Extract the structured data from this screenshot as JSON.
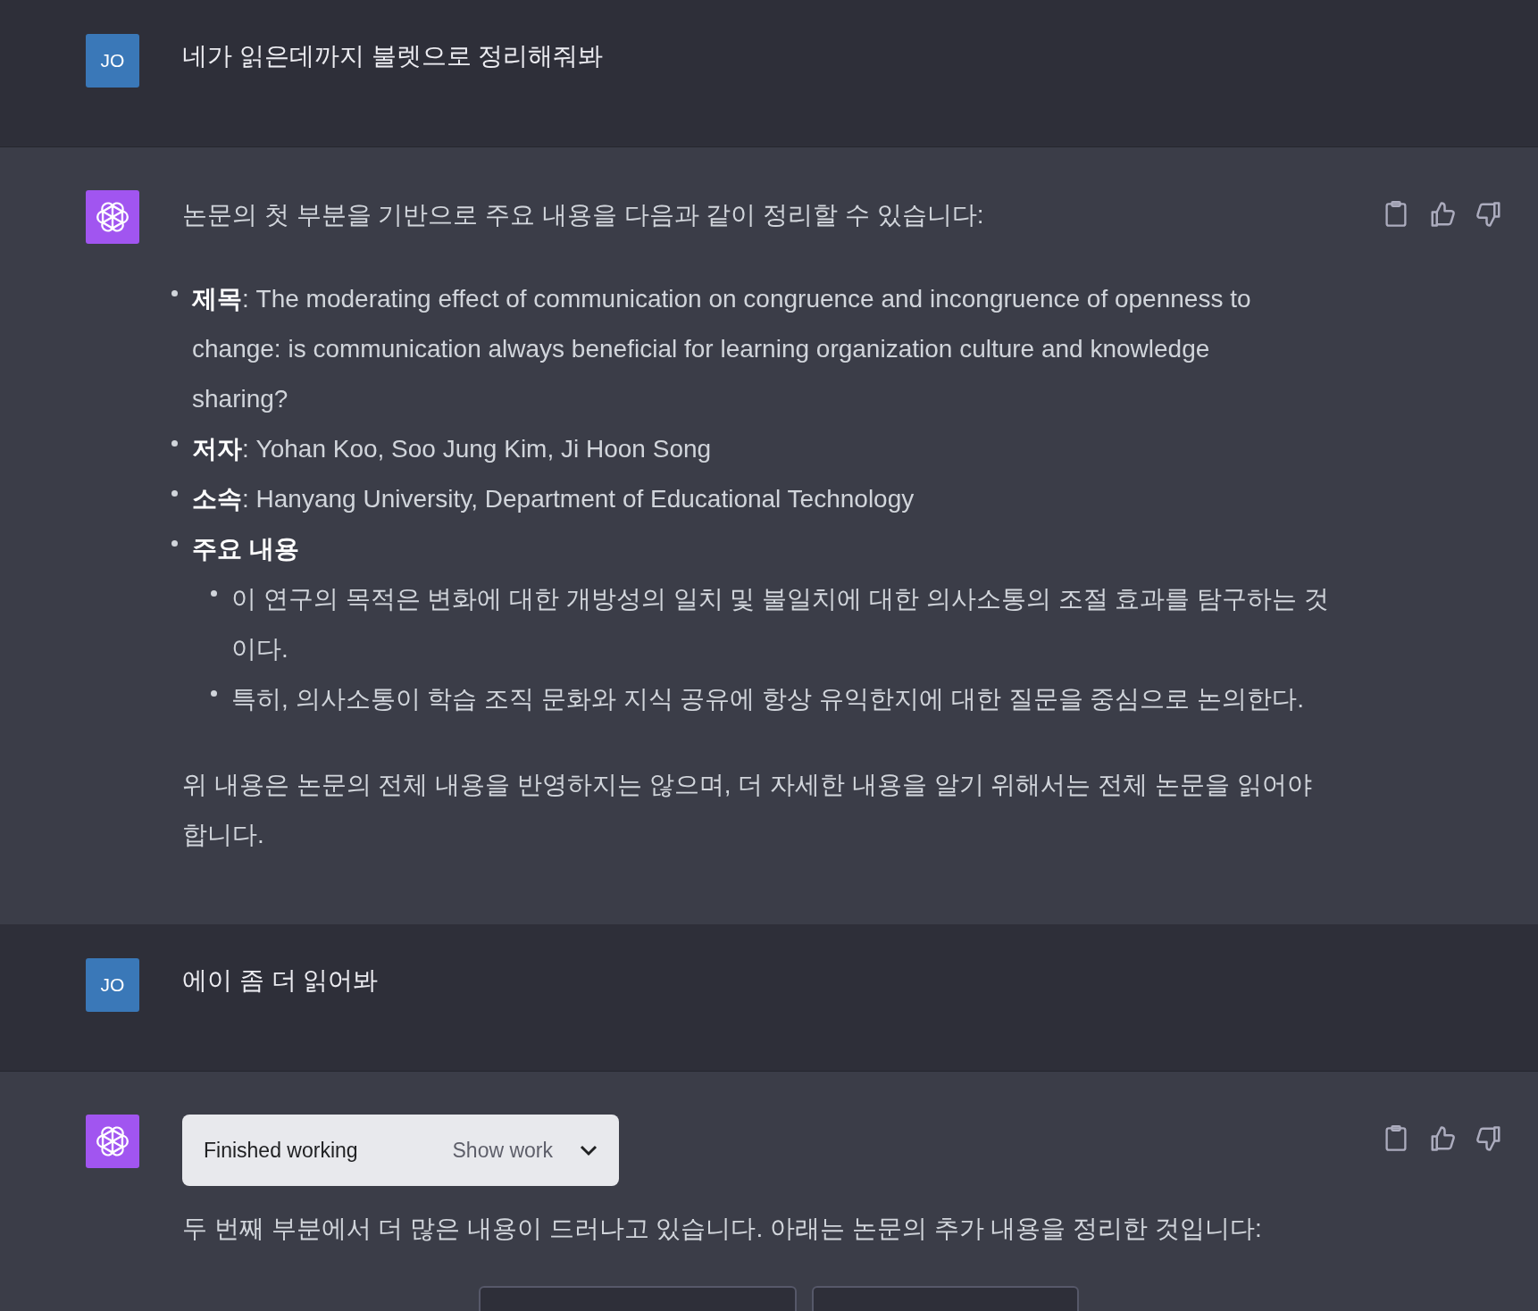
{
  "messages": [
    {
      "kind": "user",
      "avatar": "JO",
      "text": "네가 읽은데까지 불렛으로 정리해줘봐"
    },
    {
      "kind": "assistant",
      "blocks": [
        {
          "kind": "paragraph",
          "text": "논문의 첫 부분을 기반으로 주요 내용을 다음과 같이 정리할 수 있습니다:"
        },
        {
          "kind": "list",
          "items": [
            {
              "text": "**제목**: The moderating effect of communication on congruence and incongruence of openness to change: is communication always beneficial for learning organization culture and knowledge sharing?"
            },
            {
              "text": "**저자**: Yohan Koo, Soo Jung Kim, Ji Hoon Song"
            },
            {
              "text": "**소속**: Hanyang University, Department of Educational Technology"
            },
            {
              "text": "**주요 내용**",
              "children": [
                {
                  "text": "이 연구의 목적은 변화에 대한 개방성의 일치 및 불일치에 대한 의사소통의 조절 효과를 탐구하는 것이다."
                },
                {
                  "text": "특히, 의사소통이 학습 조직 문화와 지식 공유에 항상 유익한지에 대한 질문을 중심으로 논의한다."
                }
              ]
            }
          ]
        },
        {
          "kind": "paragraph",
          "text": "위 내용은 논문의 전체 내용을 반영하지는 않으며, 더 자세한 내용을 알기 위해서는 전체 논문을 읽어야 합니다."
        }
      ]
    },
    {
      "kind": "user",
      "avatar": "JO",
      "text": "에이 좀 더 읽어봐"
    },
    {
      "kind": "assistant",
      "blocks": [
        {
          "kind": "work",
          "status": "Finished working",
          "toggle": "Show work",
          "expanded": false
        },
        {
          "kind": "paragraph",
          "text": "두 번째 부분에서 더 많은 내용이 드러나고 있습니다. 아래는 논문의 추가 내용을 정리한 것입니다:"
        },
        {
          "kind": "cutoff"
        }
      ]
    }
  ]
}
